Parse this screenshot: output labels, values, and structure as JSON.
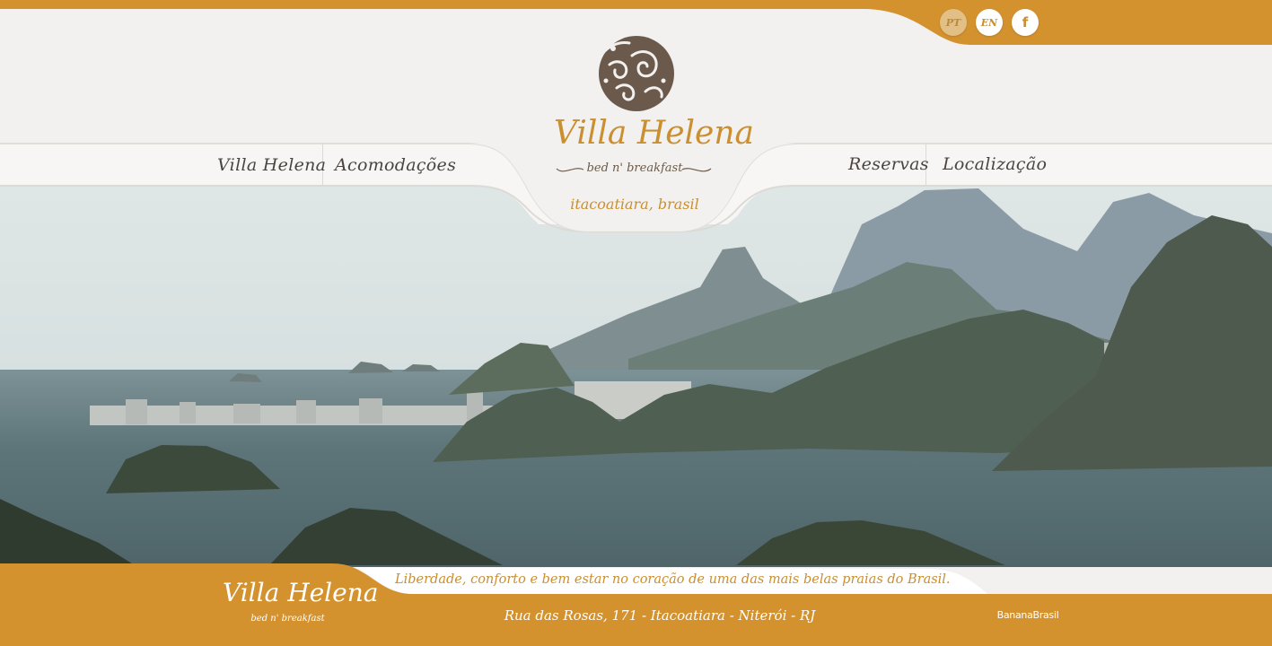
{
  "nav": {
    "left": [
      "Villa Helena",
      "Acomodações"
    ],
    "right": [
      "Reservas",
      "Localização"
    ]
  },
  "lang": {
    "pt": "PT",
    "en": "EN",
    "facebook": "f"
  },
  "logo": {
    "title": "Villa Helena",
    "subtitle": "bed n' breakfast",
    "place": "itacoatiara, brasil"
  },
  "footer": {
    "logo_title": "Villa Helena",
    "logo_subtitle": "bed n' breakfast",
    "tagline": "Liberdade, conforto e bem estar no coração de uma das mais belas praias do Brasil.",
    "address": "Rua das Rosas, 171 - Itacoatiara - Niterói - RJ",
    "credit": "BananaBrasil"
  },
  "colors": {
    "accent": "#d4922e",
    "paper": "#f2f1ef",
    "text": "#4a4440",
    "sea": "#55727a",
    "sky": "#d9e2e2"
  },
  "icons": [
    "facebook-icon",
    "logo-emblem-icon"
  ]
}
